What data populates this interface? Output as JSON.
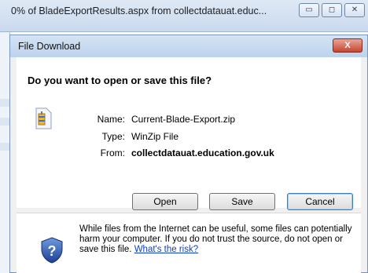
{
  "progress_window": {
    "title": "0% of BladeExportResults.aspx from collectdatauat.educ...",
    "buttons": [
      "minimize",
      "maximize",
      "close"
    ]
  },
  "dialog": {
    "title": "File Download",
    "close_label": "X",
    "question": "Do you want to open or save this file?",
    "file": {
      "name_label": "Name:",
      "name_value": "Current-Blade-Export.zip",
      "type_label": "Type:",
      "type_value": "WinZip File",
      "from_label": "From:",
      "from_value": "collectdatauat.education.gov.uk"
    },
    "buttons": {
      "open": "Open",
      "save": "Save",
      "cancel": "Cancel"
    },
    "warning": {
      "text": "While files from the Internet can be useful, some files can potentially harm your computer. If you do not trust the source, do not open or save this file.",
      "link": "What's the risk?"
    }
  },
  "icons": {
    "file": "zip-file-icon",
    "warning": "security-shield-icon"
  },
  "colors": {
    "title_bar": "#bcd2ec",
    "close_button": "#c7452f",
    "link": "#0b3fd1",
    "default_button_border": "#3c7fb1"
  }
}
